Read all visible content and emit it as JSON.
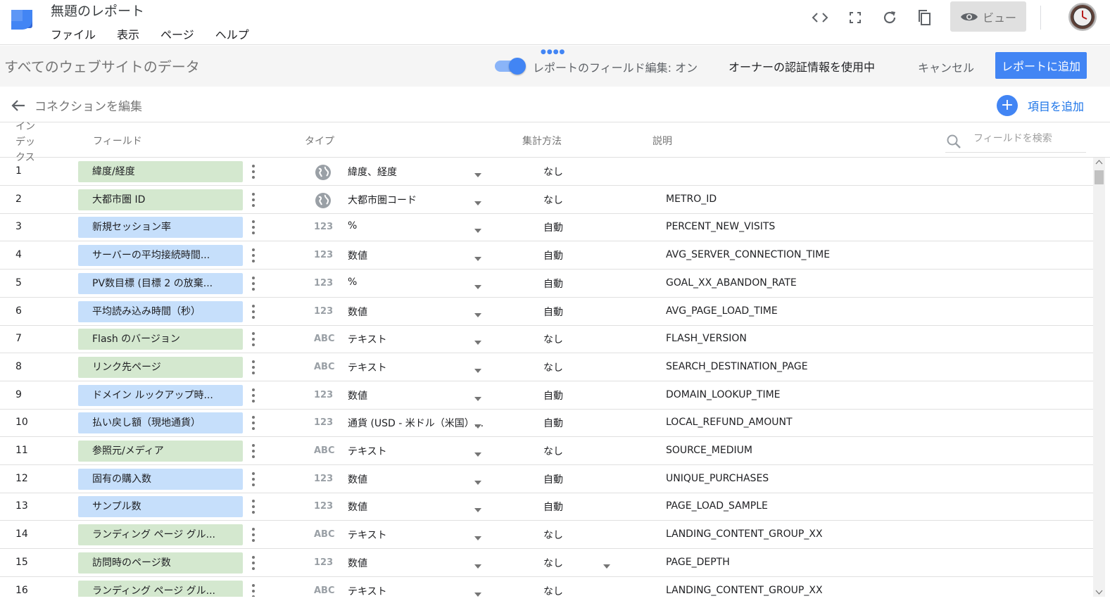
{
  "app": {
    "title": "無題のレポート",
    "menu": [
      "ファイル",
      "表示",
      "ページ",
      "ヘルプ"
    ],
    "view_button": "ビュー"
  },
  "datasource": {
    "title": "すべてのウェブサイトのデータ",
    "field_edit_toggle": "レポートのフィールド編集: オン",
    "field_edit_on": true,
    "owner_credentials": "オーナーの認証情報を使用中",
    "cancel": "キャンセル",
    "add_to_report": "レポートに追加"
  },
  "editbar": {
    "edit_connection": "コネクションを編集",
    "add_field": "項目を追加"
  },
  "table": {
    "headers": {
      "index": "インデックス",
      "field": "フィールド",
      "type": "タイプ",
      "aggregation": "集計方法",
      "description": "説明"
    },
    "search_placeholder": "フィールドを検索",
    "rows": [
      {
        "idx": "1",
        "field": "緯度/経度",
        "kind": "dimension",
        "type_icon": "globe-icon",
        "type": "緯度、経度",
        "agg": "なし",
        "desc": ""
      },
      {
        "idx": "2",
        "field": "大都市圏 ID",
        "kind": "dimension",
        "type_icon": "globe-icon",
        "type": "大都市圏コード",
        "agg": "なし",
        "desc": "METRO_ID"
      },
      {
        "idx": "3",
        "field": "新規セッション率",
        "kind": "metric",
        "type_icon": "123",
        "type": "%",
        "agg": "自動",
        "desc": "PERCENT_NEW_VISITS"
      },
      {
        "idx": "4",
        "field": "サーバーの平均接続時間...",
        "kind": "metric",
        "type_icon": "123",
        "type": "数値",
        "agg": "自動",
        "desc": "AVG_SERVER_CONNECTION_TIME"
      },
      {
        "idx": "5",
        "field": "PV数目標 (目標 2 の放棄...",
        "kind": "metric",
        "type_icon": "123",
        "type": "%",
        "agg": "自動",
        "desc": "GOAL_XX_ABANDON_RATE"
      },
      {
        "idx": "6",
        "field": "平均読み込み時間（秒）",
        "kind": "metric",
        "type_icon": "123",
        "type": "数値",
        "agg": "自動",
        "desc": "AVG_PAGE_LOAD_TIME"
      },
      {
        "idx": "7",
        "field": "Flash のバージョン",
        "kind": "dimension",
        "type_icon": "ABC",
        "type": "テキスト",
        "agg": "なし",
        "desc": "FLASH_VERSION"
      },
      {
        "idx": "8",
        "field": "リンク先ページ",
        "kind": "dimension",
        "type_icon": "ABC",
        "type": "テキスト",
        "agg": "なし",
        "desc": "SEARCH_DESTINATION_PAGE"
      },
      {
        "idx": "9",
        "field": "ドメイン ルックアップ時...",
        "kind": "metric",
        "type_icon": "123",
        "type": "数値",
        "agg": "自動",
        "desc": "DOMAIN_LOOKUP_TIME"
      },
      {
        "idx": "10",
        "field": "払い戻し額（現地通貨）",
        "kind": "metric",
        "type_icon": "123",
        "type": "通貨 (USD - 米ドル（米国）...",
        "agg": "自動",
        "desc": "LOCAL_REFUND_AMOUNT"
      },
      {
        "idx": "11",
        "field": "参照元/メディア",
        "kind": "dimension",
        "type_icon": "ABC",
        "type": "テキスト",
        "agg": "なし",
        "desc": "SOURCE_MEDIUM"
      },
      {
        "idx": "12",
        "field": "固有の購入数",
        "kind": "metric",
        "type_icon": "123",
        "type": "数値",
        "agg": "自動",
        "desc": "UNIQUE_PURCHASES"
      },
      {
        "idx": "13",
        "field": "サンプル数",
        "kind": "metric",
        "type_icon": "123",
        "type": "数値",
        "agg": "自動",
        "desc": "PAGE_LOAD_SAMPLE"
      },
      {
        "idx": "14",
        "field": "ランディング ページ グル...",
        "kind": "dimension",
        "type_icon": "ABC",
        "type": "テキスト",
        "agg": "なし",
        "desc": "LANDING_CONTENT_GROUP_XX"
      },
      {
        "idx": "15",
        "field": "訪問時のページ数",
        "kind": "dimension",
        "type_icon": "123",
        "type": "数値",
        "agg": "なし",
        "agg_dropdown": true,
        "desc": "PAGE_DEPTH"
      },
      {
        "idx": "16",
        "field": "ランディング ページ グル...",
        "kind": "dimension",
        "type_icon": "ABC",
        "type": "テキスト",
        "agg": "なし",
        "desc": "LANDING_CONTENT_GROUP_XX"
      }
    ]
  },
  "colors": {
    "accent": "#4285f4",
    "dimension_chip": "#d4e8cf",
    "metric_chip": "#c6dffb"
  }
}
